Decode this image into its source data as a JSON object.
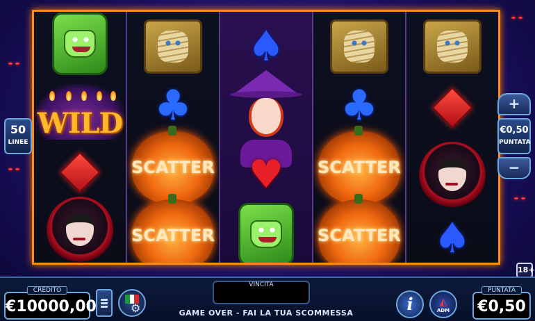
{
  "side": {
    "lines_value": "50",
    "lines_label": "LINEE",
    "bet_value": "€0,50",
    "bet_label": "PUNTATA",
    "plus_label": "+",
    "minus_label": "−",
    "age_label": "18+"
  },
  "reels": [
    {
      "symbols": [
        "monster",
        "wild",
        "diamond",
        "vampire"
      ],
      "wild_text": "WILD"
    },
    {
      "symbols": [
        "mummy",
        "club",
        "pumpkin",
        "pumpkin"
      ]
    },
    {
      "symbols": [
        "spade",
        "witch",
        "heart",
        "monster"
      ]
    },
    {
      "symbols": [
        "mummy",
        "club",
        "pumpkin",
        "pumpkin"
      ]
    },
    {
      "symbols": [
        "mummy",
        "diamond",
        "vampire",
        "spade"
      ]
    }
  ],
  "scatter_text": "SCATTER",
  "wild_text": "WILD",
  "bottom": {
    "credit_label": "CREDITO",
    "credit_value": "€10000,00",
    "win_label": "VINCITA",
    "win_value": "",
    "status": "GAME OVER - FAI LA TUA SCOMMESSA",
    "bet_label": "PUNTATA",
    "bet_value": "€0,50",
    "info_label": "i",
    "adm_label": "ADM"
  },
  "colors": {
    "frame": "#ff8a1a",
    "panel_border": "#6fa8e0",
    "background": "#2a1a8a"
  }
}
